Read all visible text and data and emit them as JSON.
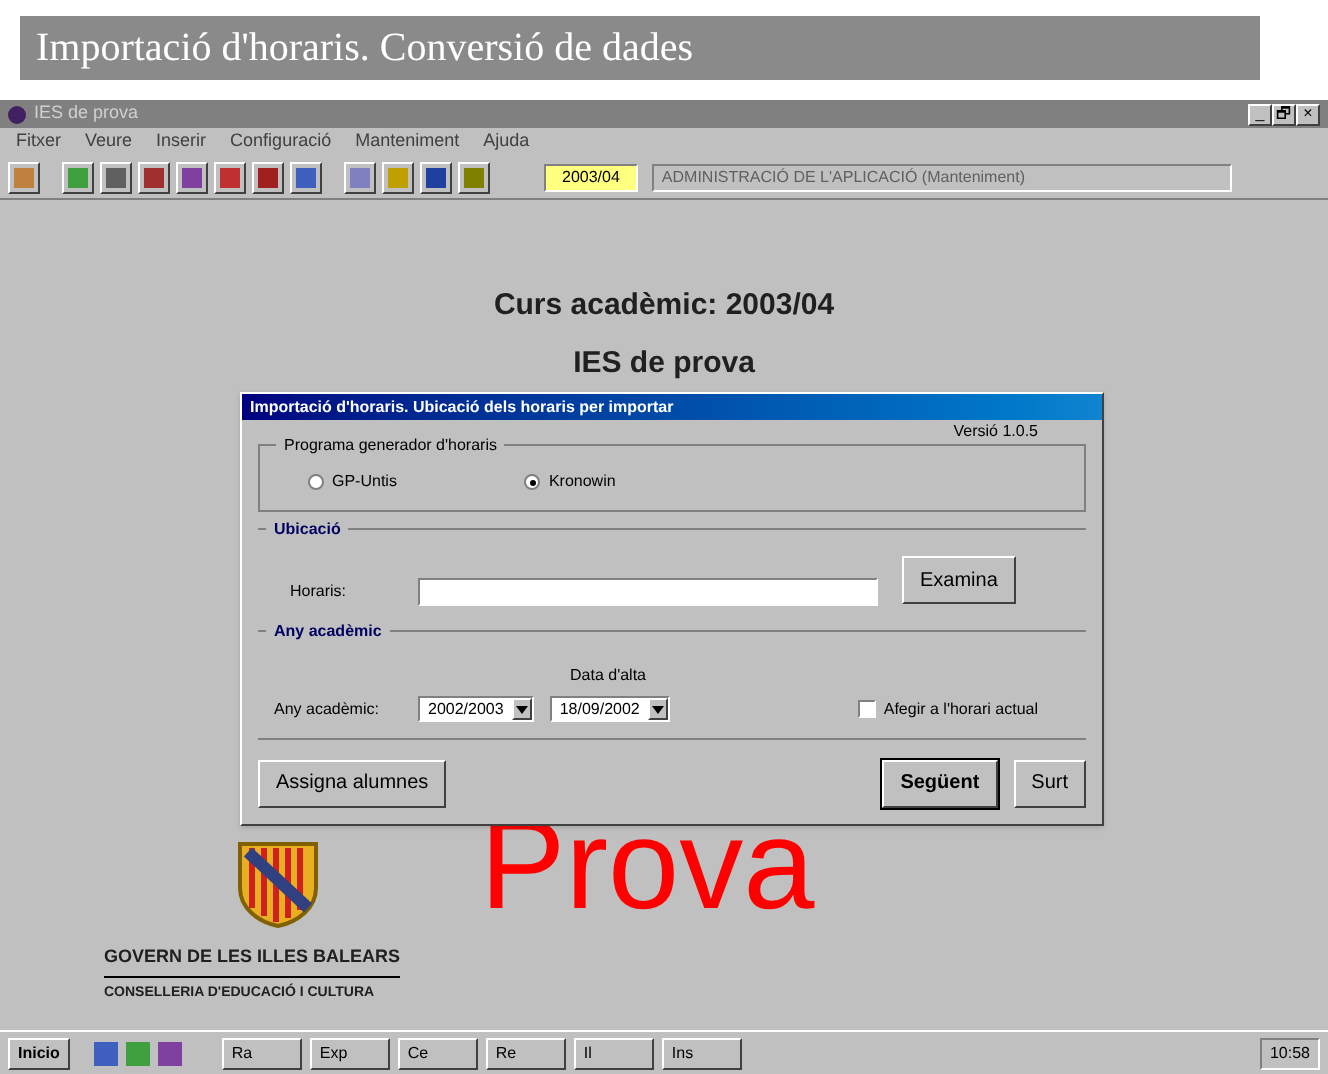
{
  "banner": {
    "title": "Importació d'horaris. Conversió de dades"
  },
  "window": {
    "title": "IES de prova",
    "controls": [
      "_",
      "🗗",
      "×"
    ]
  },
  "menu": [
    "Fitxer",
    "Veure",
    "Inserir",
    "Configuració",
    "Manteniment",
    "Ajuda"
  ],
  "toolbar": {
    "course": "2003/04",
    "status": "ADMINISTRACIÓ DE L'APLICACIÓ  (Manteniment)"
  },
  "header": {
    "course": "Curs acadèmic: 2003/04",
    "school": "IES de prova"
  },
  "dialog": {
    "title": "Importació d'horaris. Ubicació dels horaris per importar",
    "version": "Versió 1.0.5",
    "generator": {
      "legend": "Programa generador d'horaris",
      "options": [
        {
          "label": "GP-Untis",
          "selected": false
        },
        {
          "label": "Kronowin",
          "selected": true
        }
      ]
    },
    "location": {
      "legend": "Ubicació",
      "label": "Horaris:",
      "browse": "Examina"
    },
    "year": {
      "legend": "Any acadèmic",
      "label": "Any acadèmic:",
      "value": "2002/2003",
      "date_label": "Data d'alta",
      "date": "18/09/2002",
      "append": {
        "label": "Afegir a l'horari actual",
        "checked": false
      }
    },
    "buttons": [
      {
        "label": "Assigna alumnes",
        "default": false
      },
      {
        "label": "Següent",
        "default": true
      },
      {
        "label": "Surt",
        "default": false
      }
    ]
  },
  "watermark_text": "Prova",
  "logo": {
    "line1": "GOVERN DE LES ILLES BALEARS",
    "line2": "CONSELLERIA D'EDUCACIÓ I CULTURA"
  },
  "taskbar": {
    "start": "Inicio",
    "tasks": [
      "Ra",
      "Exp",
      "Ce",
      "Re",
      "Il",
      "Ins"
    ],
    "clock": "10:58"
  }
}
